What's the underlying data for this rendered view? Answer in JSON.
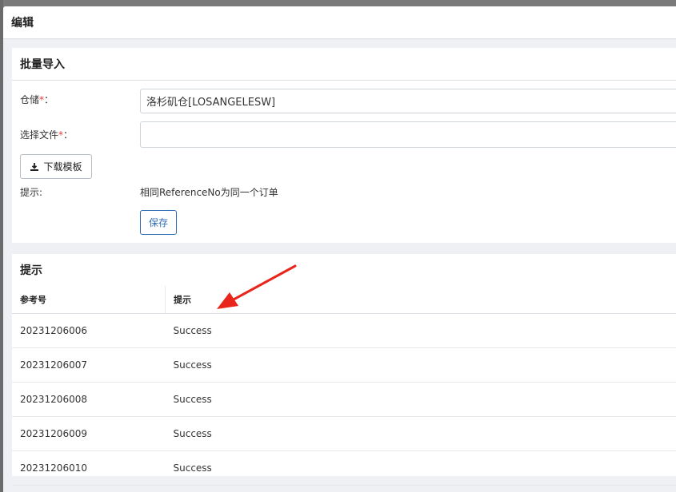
{
  "dialog": {
    "title": "编辑"
  },
  "import_panel": {
    "title": "批量导入",
    "warehouse_label": "仓储",
    "warehouse_value": "洛杉矶仓[LOSANGELESW]",
    "file_label": "选择文件",
    "file_value": "",
    "required_mark": "*",
    "colon": "：",
    "download_label": "下载模板",
    "tip_label": "提示:",
    "tip_text": "相同ReferenceNo为同一个订单",
    "save_label": "保存"
  },
  "tip_panel": {
    "title": "提示",
    "columns": [
      "参考号",
      "提示"
    ],
    "rows": [
      [
        "20231206006",
        "Success"
      ],
      [
        "20231206007",
        "Success"
      ],
      [
        "20231206008",
        "Success"
      ],
      [
        "20231206009",
        "Success"
      ],
      [
        "20231206010",
        "Success"
      ]
    ]
  },
  "colors": {
    "primary": "#2e6db4",
    "required": "#e53935",
    "annotation_arrow": "#e8261c"
  },
  "icons": {
    "download": "download-icon"
  }
}
